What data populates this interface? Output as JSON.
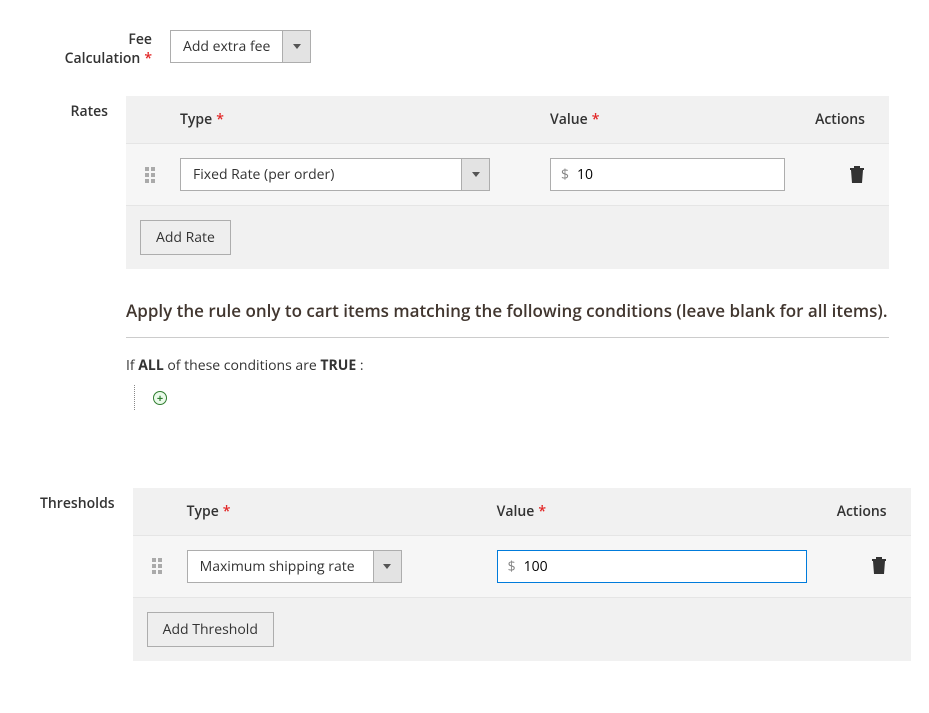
{
  "fee_calc": {
    "label": "Fee Calculation",
    "value": "Add extra fee"
  },
  "rates": {
    "label": "Rates",
    "head": {
      "type": "Type",
      "value": "Value",
      "actions": "Actions"
    },
    "row": {
      "type": "Fixed Rate (per order)",
      "currency": "$",
      "value": "10"
    },
    "add_btn": "Add Rate"
  },
  "conditions": {
    "heading": "Apply the rule only to cart items matching the following conditions (leave blank for all items).",
    "line_prefix": "If ",
    "line_all": "ALL",
    "line_mid": "  of these conditions are ",
    "line_true": "TRUE",
    "line_suffix": " :"
  },
  "thresholds": {
    "label": "Thresholds",
    "head": {
      "type": "Type",
      "value": "Value",
      "actions": "Actions"
    },
    "row": {
      "type": "Maximum shipping rate",
      "currency": "$",
      "value": "100"
    },
    "add_btn": "Add Threshold"
  }
}
